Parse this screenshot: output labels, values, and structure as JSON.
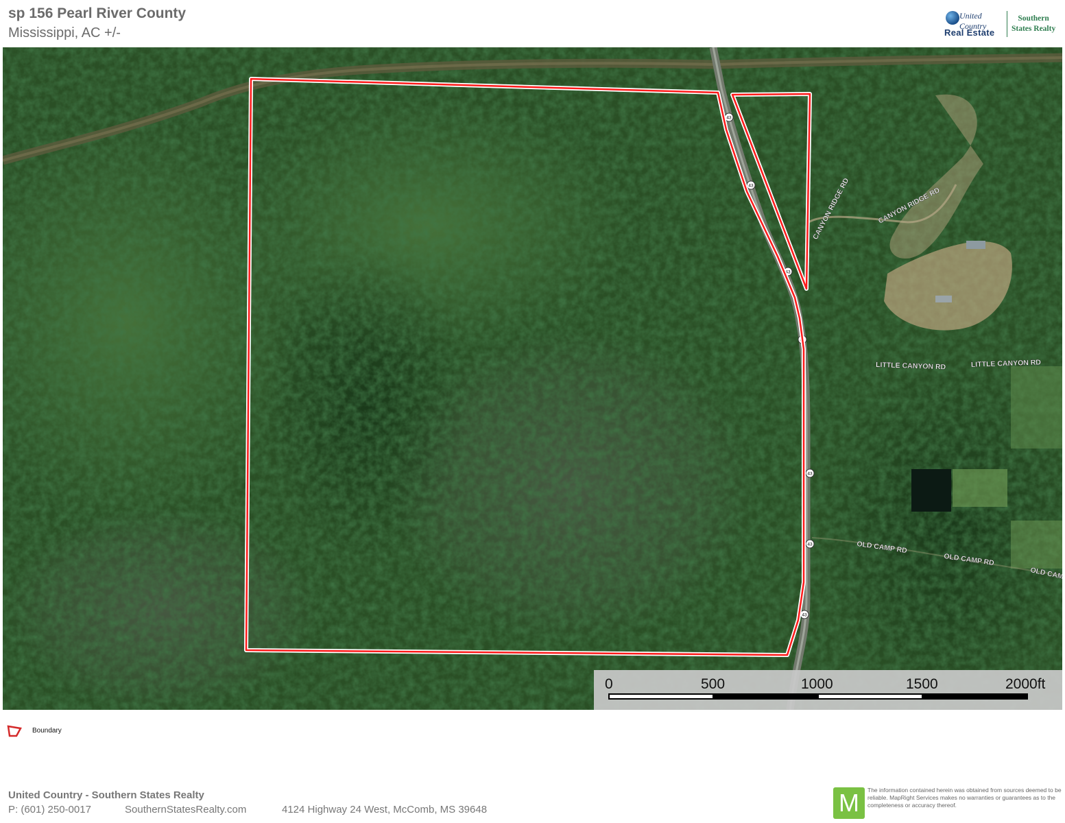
{
  "header": {
    "title": "sp 156 Pearl River County",
    "subtitle": "Mississippi,  AC +/-"
  },
  "logo": {
    "united_text": "United Country",
    "real_estate_text": "Real Estate",
    "southern_text": "Southern",
    "states_realty_text": "States Realty"
  },
  "map": {
    "boundary_color": "#ff1a1a",
    "road_labels": [
      "CANYON RIDGE RD",
      "CANYON RIDGE RD",
      "LITTLE CANYON RD",
      "LITTLE CANYON RD",
      "OLD CAMP RD",
      "OLD CAMP RD",
      "OLD CAM"
    ],
    "route_shield": "43"
  },
  "scale": {
    "labels": [
      "0",
      "500",
      "1000",
      "1500",
      "2000ft"
    ]
  },
  "legend": {
    "boundary_label": "Boundary"
  },
  "footer": {
    "company": "United Country - Southern States Realty",
    "phone": "P: (601) 250-0017",
    "website": "SouthernStatesRealty.com",
    "address": "4124 Highway 24 West, McComb, MS 39648",
    "disclaimer": "The information contained herein was obtained from sources deemed to be reliable. MapRight Services makes no warranties or guarantees as to the completeness or accuracy thereof.",
    "mapright_letter": "M"
  }
}
